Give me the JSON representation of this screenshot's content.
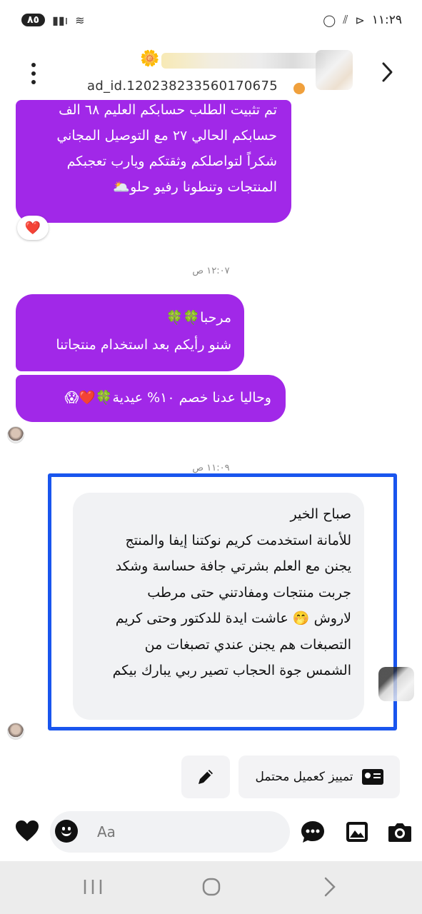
{
  "status_bar": {
    "battery": "٨٥",
    "time": "١١:٢٩"
  },
  "header": {
    "ad_id": "ad_id.120238233560170675",
    "name_flower": "🌼"
  },
  "messages": {
    "first": {
      "lines": [
        "تم تثبيت الطلب حسابكم العليم ٦٨ الف",
        "حسابكم الحالي ٢٧ مع التوصيل المجاني",
        "شكراً لتواصلكم وثقتكم ويارب تعجبكم",
        "المنتجات وتنطونا رفيو حلو🌥️"
      ],
      "reaction": "❤️"
    },
    "timestamp_1": "١٢:٠٧ ص",
    "second": {
      "lines": [
        "مرحبا🍀🍀",
        "شنو رأيكم بعد استخدام منتجاتنا"
      ]
    },
    "third": {
      "lines": [
        "وحاليا  عدنا خصم ١٠% عيدية🍀❤️😱"
      ]
    },
    "timestamp_2": "١١:٠٩ ص",
    "reply": {
      "lines": [
        "صباح الخير",
        "للأمانة استخدمت كريم نوكتنا إيفا والمنتج",
        "يجنن مع العلم بشرتي جافة حساسة وشكد",
        "جربت منتجات ومفادتني حتى مرطب",
        "لاروش 🤭 عاشت ايدة للدكتور وحتى كريم",
        "التصبغات هم يجنن عندي تصبغات من",
        "الشمس جوة الحجاب تصير ربي يبارك بيكم"
      ]
    }
  },
  "actions": {
    "mark_customer": "تمييز كعميل محتمل"
  },
  "composer": {
    "placeholder": "Aa"
  },
  "colors": {
    "sent_bubble": "#a128e8",
    "received_bubble": "#f1f2f4",
    "highlight": "#1955ee",
    "ad_dot": "#f0a03c"
  }
}
